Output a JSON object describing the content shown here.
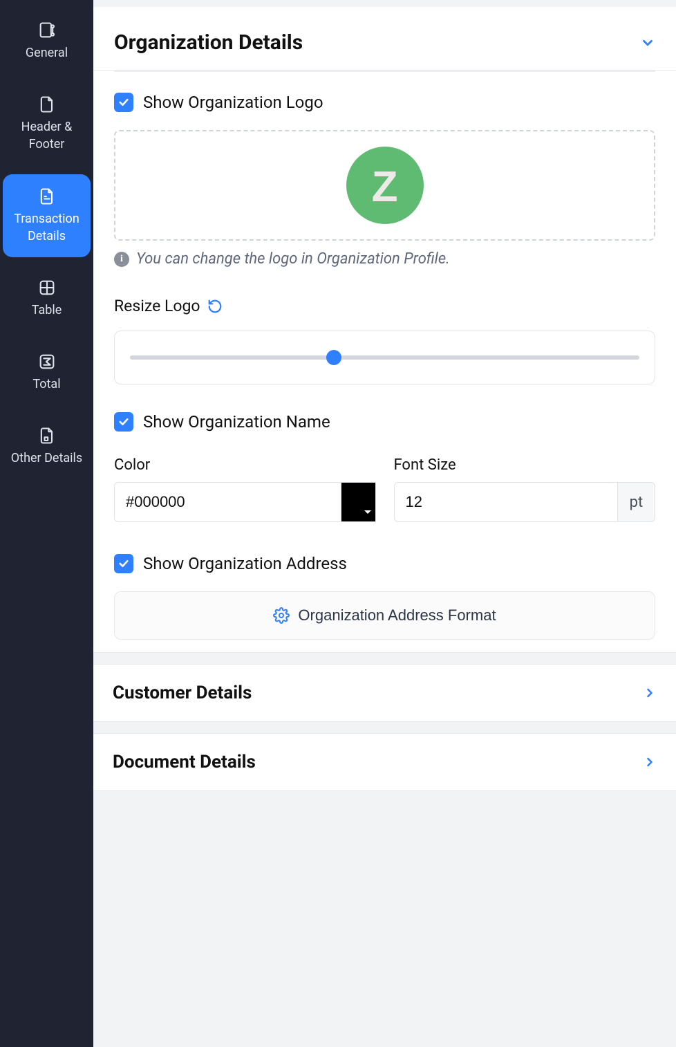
{
  "sidebar": {
    "items": [
      {
        "label": "General"
      },
      {
        "label": "Header & Footer"
      },
      {
        "label": "Transaction Details"
      },
      {
        "label": "Table"
      },
      {
        "label": "Total"
      },
      {
        "label": "Other Details"
      }
    ],
    "activeIndex": 2
  },
  "org_details": {
    "title": "Organization Details",
    "show_logo_label": "Show Organization Logo",
    "show_logo_checked": true,
    "logo_hint": "You can change the logo in Organization Profile.",
    "resize_label": "Resize Logo",
    "slider_percent": 40,
    "show_name_label": "Show Organization Name",
    "show_name_checked": true,
    "color_label": "Color",
    "color_value": "#000000",
    "fontsize_label": "Font Size",
    "fontsize_value": "12",
    "fontsize_unit": "pt",
    "show_address_label": "Show Organization Address",
    "show_address_checked": true,
    "address_format_btn": "Organization Address Format"
  },
  "customer_section": {
    "title": "Customer Details"
  },
  "document_section": {
    "title": "Document Details"
  }
}
